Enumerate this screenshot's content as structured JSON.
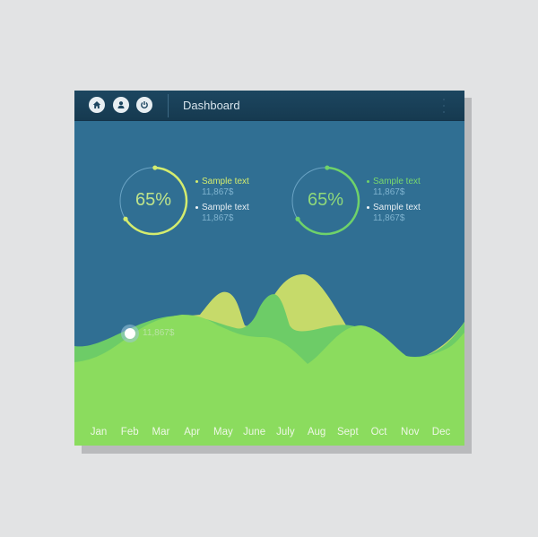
{
  "window": {
    "title": "Dashboard",
    "header_icons": [
      "home-icon",
      "user-icon",
      "power-icon"
    ],
    "menu_icon": "kebab-menu-icon"
  },
  "colors": {
    "background": "#e2e3e4",
    "panel": "#306f93",
    "header": "#1a4159",
    "accent_yellow": "#d4e86a",
    "accent_green": "#6fd26a",
    "area_front": "#8bdc5e",
    "area_mid": "#6fcc66",
    "area_back": "#c6da6a"
  },
  "gauges": [
    {
      "percent_label": "65%",
      "value": 0.65,
      "color": "#d4ec6e",
      "legend": [
        {
          "label": "Sample text",
          "value": "11,867$",
          "highlight": true
        },
        {
          "label": "Sample text",
          "value": "11,867$",
          "highlight": false
        }
      ]
    },
    {
      "percent_label": "65%",
      "value": 0.65,
      "color": "#6fd26a",
      "legend": [
        {
          "label": "Sample text",
          "value": "11,867$",
          "highlight": true
        },
        {
          "label": "Sample text",
          "value": "11,867$",
          "highlight": false
        }
      ]
    }
  ],
  "chart": {
    "months": [
      "Jan",
      "Feb",
      "Mar",
      "Apr",
      "May",
      "June",
      "July",
      "Aug",
      "Sept",
      "Oct",
      "Nov",
      "Dec"
    ],
    "marker": {
      "month_index": 1,
      "label": "11,867$"
    }
  }
}
